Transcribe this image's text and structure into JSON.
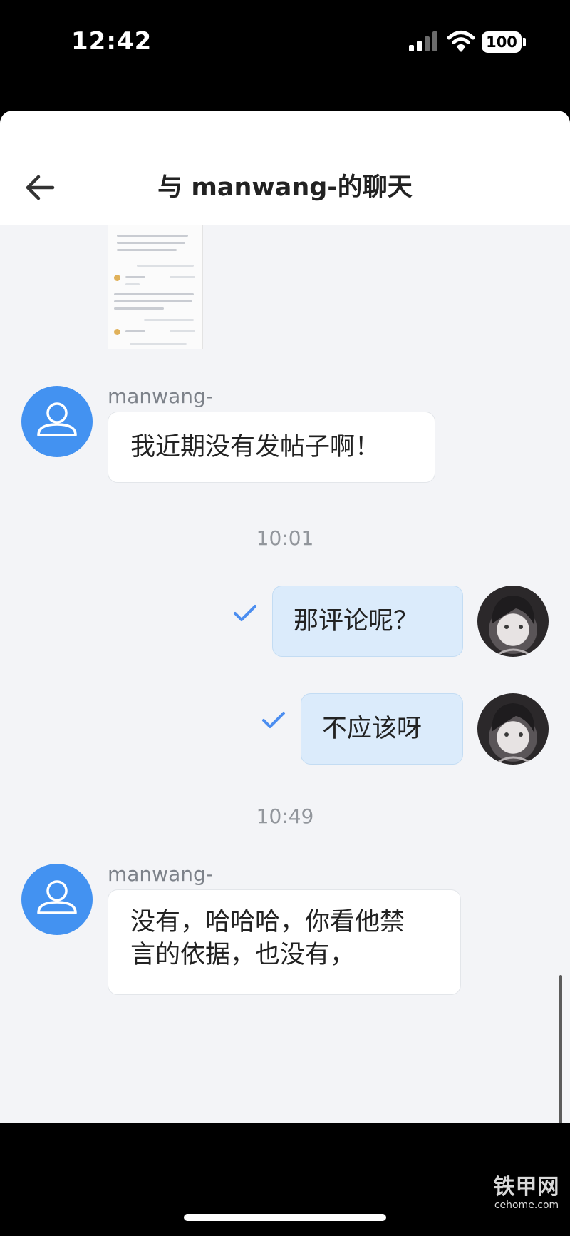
{
  "status_bar": {
    "time": "12:42",
    "battery": "100"
  },
  "header": {
    "title": "与 manwang-的聊天"
  },
  "messages": [
    {
      "type": "incoming",
      "sender": "manwang-",
      "text": "我近期没有发帖子啊！"
    },
    {
      "type": "timestamp",
      "text": "10:01"
    },
    {
      "type": "outgoing",
      "text": "那评论呢？",
      "status": "read"
    },
    {
      "type": "outgoing",
      "text": "不应该呀",
      "status": "read"
    },
    {
      "type": "timestamp",
      "text": "10:49"
    },
    {
      "type": "incoming",
      "sender": "manwang-",
      "text": "没有，哈哈哈，你看他禁言的依据，也没有，",
      "lines": [
        "没有，哈哈哈，你看他禁",
        "言的依据，也没有，"
      ]
    }
  ],
  "input": {
    "value": "",
    "placeholder": ""
  },
  "watermark": {
    "cn": "铁甲网",
    "en": "cehome.com"
  },
  "colors": {
    "accent": "#4392f1",
    "outgoing_bubble": "#dbebfb",
    "incoming_bubble": "#ffffff",
    "chat_background": "#f3f4f7"
  },
  "icons": {
    "back": "arrow-left-icon",
    "voice": "voice-icon",
    "emoji": "smiley-icon",
    "more": "plus-circle-icon",
    "read": "checkmark-icon",
    "avatar": "user-icon"
  }
}
